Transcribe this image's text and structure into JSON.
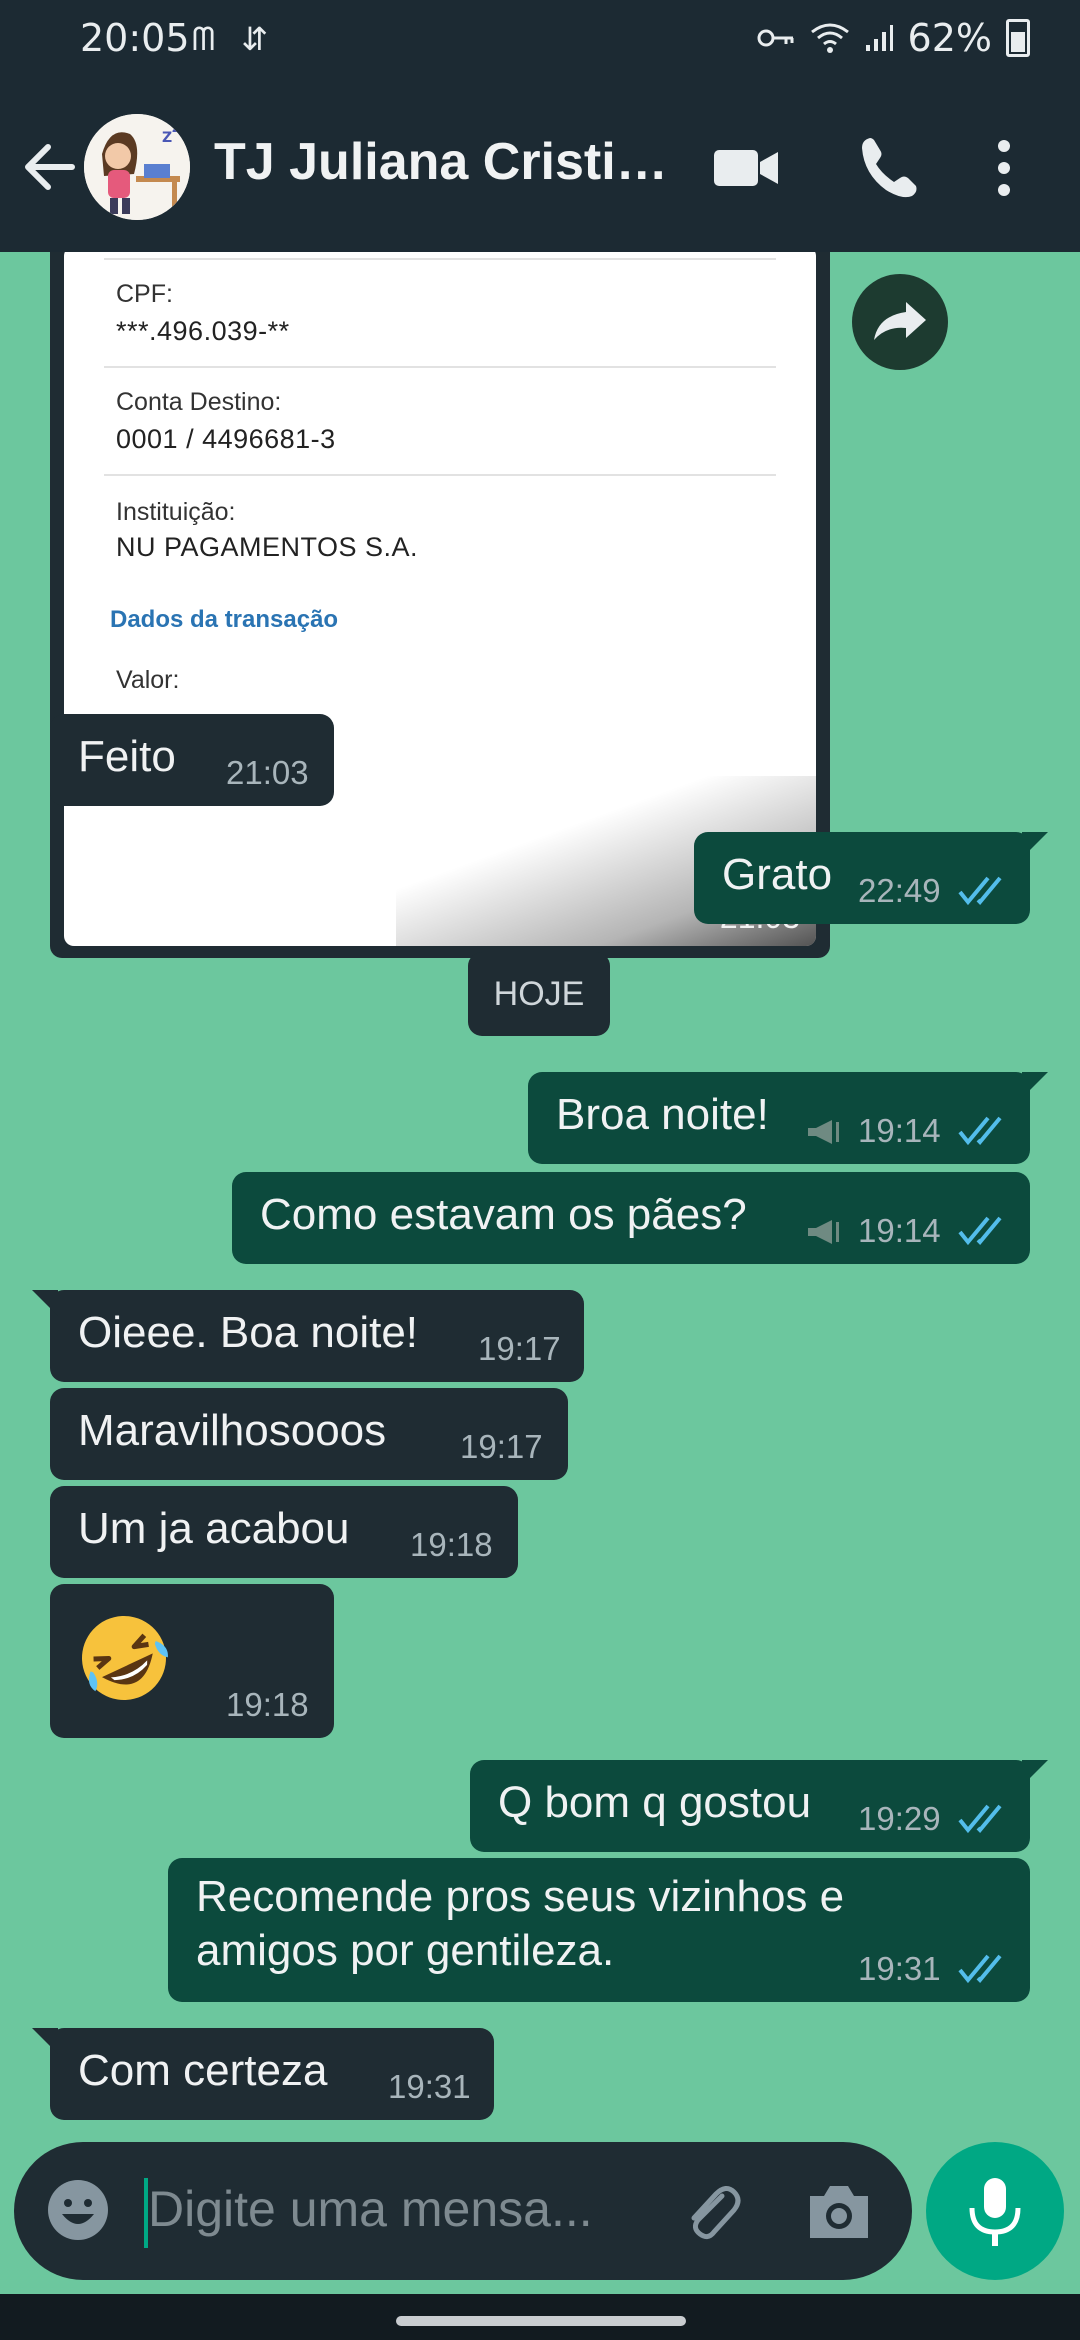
{
  "status_bar": {
    "time": "20:05",
    "left_icons": "ᗰ ⇵",
    "battery": "62%",
    "battery_level": 0.62
  },
  "header": {
    "contact_name": "TJ Juliana Cristin...",
    "back_icon": "arrow-left",
    "video_icon": "video-camera",
    "call_icon": "phone",
    "menu_icon": "more-vertical"
  },
  "image_message": {
    "cpf_label": "CPF:",
    "cpf_value": "***.496.039-**",
    "account_label": "Conta Destino:",
    "account_value": "0001 / 4496681-3",
    "institution_label": "Instituição:",
    "institution_value": "NU PAGAMENTOS S.A.",
    "section_title": "Dados da transação",
    "value_label": "Valor:",
    "time": "21:03"
  },
  "messages": [
    {
      "dir": "in",
      "text": "Feito",
      "time": "21:03"
    },
    {
      "dir": "out",
      "text": "Grato",
      "time": "22:49"
    },
    {
      "dir": "out",
      "text": "Broa noite!",
      "time": "19:14",
      "broadcast": true
    },
    {
      "dir": "out",
      "text": "Como estavam os pães?",
      "time": "19:14",
      "broadcast": true
    },
    {
      "dir": "in",
      "text": "Oieee. Boa noite!",
      "time": "19:17"
    },
    {
      "dir": "in",
      "text": "Maravilhosooos",
      "time": "19:17"
    },
    {
      "dir": "in",
      "text": "Um ja acabou",
      "time": "19:18"
    },
    {
      "dir": "in",
      "text": "🤣",
      "time": "19:18"
    },
    {
      "dir": "out",
      "text": "Q bom q gostou",
      "time": "19:29"
    },
    {
      "dir": "out",
      "text": "Recomende pros seus vizinhos e",
      "text2": "amigos por gentileza.",
      "time": "19:31"
    },
    {
      "dir": "in",
      "text": "Com certeza",
      "time": "19:31"
    }
  ],
  "day_divider": "HOJE",
  "input": {
    "placeholder": "Digite uma mensa...",
    "emoji_icon": "emoji",
    "attach_icon": "paperclip",
    "camera_icon": "camera",
    "mic_icon": "microphone"
  },
  "colors": {
    "wallpaper": "#6cc79e",
    "incoming": "#1f2c33",
    "outgoing": "#0c4a3d",
    "read_ticks": "#53bdeb",
    "accent": "#00a884"
  }
}
